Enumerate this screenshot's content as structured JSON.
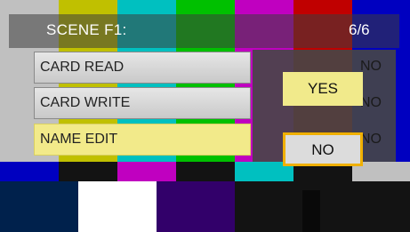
{
  "header": {
    "title": "SCENE F1:",
    "page_count": "6/6"
  },
  "menu": {
    "items": [
      {
        "label": "CARD READ",
        "value": "NO"
      },
      {
        "label": "CARD WRITE",
        "value": "NO"
      },
      {
        "label": "NAME EDIT",
        "value": "NO",
        "selected": true
      }
    ]
  },
  "dialog": {
    "yes_label": "YES",
    "no_label": "NO"
  },
  "colors": {
    "selected_item": "#f2ea8a",
    "focus_border": "#f0b000",
    "yes_button": "#f1ea8b",
    "no_button": "#dcdcdc"
  }
}
